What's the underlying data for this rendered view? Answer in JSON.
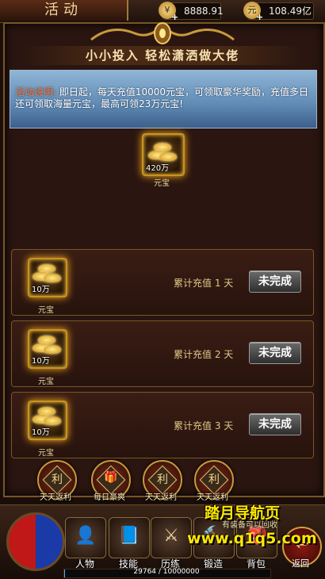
{
  "header": {
    "title": "活动",
    "resources": [
      {
        "icon": "silver-coin-icon",
        "value": "8888.91"
      },
      {
        "icon": "gold-ingot-icon",
        "value": "108.49亿"
      }
    ]
  },
  "banner": {
    "title": "小小投入 轻松潇洒做大佬"
  },
  "notice": {
    "label": "活动说明:",
    "text": "即日起，每天充值10000元宝，可领取豪华奖励，充值多日还可领取海量元宝，最高可领23万元宝!"
  },
  "grand_reward": {
    "qty": "420万",
    "name": "元宝"
  },
  "tasks": [
    {
      "qty": "10万",
      "name": "元宝",
      "condition": "累计充值 1 天",
      "button": "未完成"
    },
    {
      "qty": "10万",
      "name": "元宝",
      "condition": "累计充值 2 天",
      "button": "未完成"
    },
    {
      "qty": "10万",
      "name": "元宝",
      "condition": "累计充值 3 天",
      "button": "未完成"
    }
  ],
  "activity_tabs": [
    {
      "glyph": "利",
      "label": "天天返利"
    },
    {
      "glyph": "🎁",
      "label": "每日豪爽"
    },
    {
      "glyph": "利",
      "label": "天天返利"
    },
    {
      "glyph": "利",
      "label": "天天返利"
    }
  ],
  "hint": "有装备可以回收",
  "menu": [
    {
      "label": "人物",
      "icon": "character-icon",
      "glyph": "👤"
    },
    {
      "label": "技能",
      "icon": "skill-book-icon",
      "glyph": "📘"
    },
    {
      "label": "历练",
      "icon": "training-icon",
      "glyph": "⚔"
    },
    {
      "label": "锻造",
      "icon": "forge-icon",
      "glyph": "🔨"
    },
    {
      "label": "背包",
      "icon": "backpack-icon",
      "glyph": "🎒"
    }
  ],
  "back_label": "返回",
  "xp": {
    "text": "29764 / 10000000",
    "progress": 0.003
  },
  "watermark": {
    "line1": "踏月导航页",
    "line2": "www.q1q5.com"
  }
}
